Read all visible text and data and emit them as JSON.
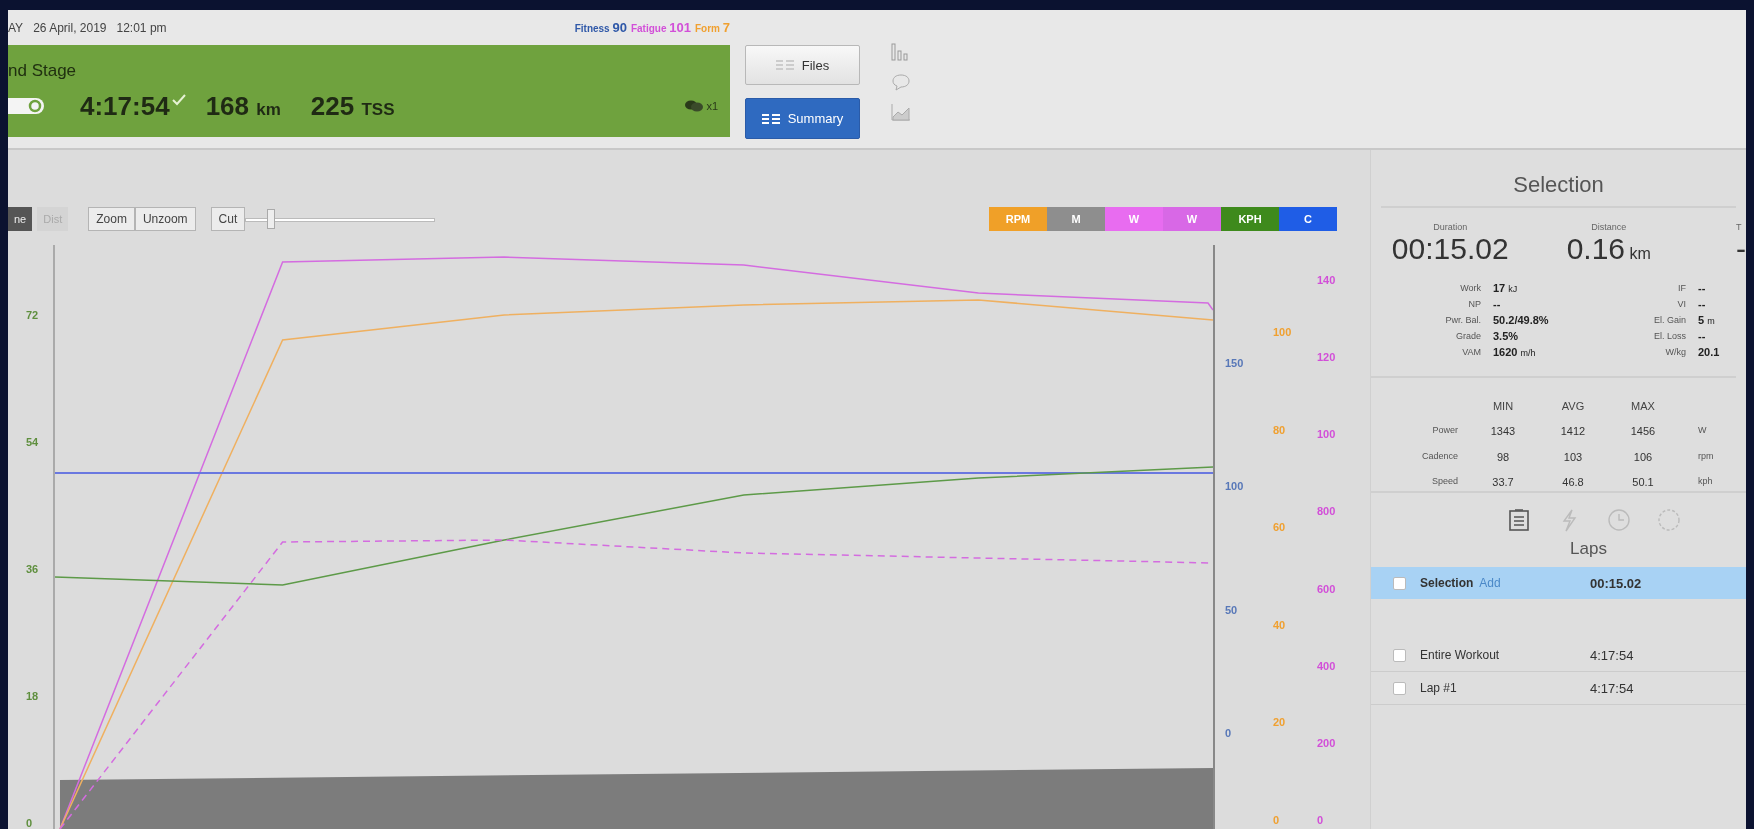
{
  "header": {
    "day": "AY",
    "date": "26 April, 2019",
    "time": "12:01 pm",
    "metrics": [
      {
        "label": "Fitness",
        "value": "90",
        "color": "#2f58a8"
      },
      {
        "label": "Fatigue",
        "value": "101",
        "color": "#d24fd8"
      },
      {
        "label": "Form",
        "value": "7",
        "color": "#f0a030"
      }
    ],
    "workout": {
      "title": "nd Stage",
      "duration": "4:17:54",
      "completed": true,
      "distance": "168",
      "distance_unit": "km",
      "tss": "225",
      "tss_unit": "TSS",
      "comments": "x1"
    },
    "buttons": [
      {
        "label": "Files",
        "selected": false
      },
      {
        "label": "Summary",
        "selected": true
      }
    ],
    "views": [
      {
        "kind": "bars"
      },
      {
        "kind": "comment"
      },
      {
        "kind": "chart"
      }
    ]
  },
  "toolbar": {
    "modes": [
      {
        "label": "ne",
        "selected": true
      },
      {
        "label": "Dist",
        "selected": false
      }
    ],
    "actions": [
      "Zoom",
      "Unzoom",
      "Cut"
    ],
    "zoom": {
      "level": 0.12
    },
    "legend": [
      {
        "label": "RPM",
        "color": "#f0a028"
      },
      {
        "label": "M",
        "color": "#8e8e8e"
      },
      {
        "label": "W",
        "color": "#e86cf0"
      },
      {
        "label": "W",
        "color": "#d868e6"
      },
      {
        "label": "KPH",
        "color": "#3e8a1c"
      },
      {
        "label": "C",
        "color": "#1f5de6"
      }
    ]
  },
  "axes": {
    "left": {
      "color": "#5f8f3e",
      "ticks": [
        "72",
        "54",
        "36",
        "18",
        "0"
      ]
    },
    "right": [
      {
        "color": "#5878b8",
        "ticks": [
          "150",
          "100",
          "50",
          "0"
        ]
      },
      {
        "color": "#f0a030",
        "ticks": [
          "100",
          "80",
          "60",
          "40",
          "20",
          "0"
        ]
      },
      {
        "color": "#d24fd8",
        "ticks": [
          "140",
          "120",
          "100",
          "800",
          "600",
          "400",
          "200",
          "0"
        ]
      }
    ]
  },
  "selection": {
    "title": "Selection",
    "summary": [
      {
        "label": "Duration",
        "value": "00:15.02"
      },
      {
        "label": "Distance",
        "value": "0.16",
        "unit": "km"
      },
      {
        "label": "T",
        "value": "-"
      }
    ],
    "metrics": [
      {
        "label": "Work",
        "value": "17",
        "unit": "kJ"
      },
      {
        "label": "NP",
        "value": "--"
      },
      {
        "label": "Pwr. Bal.",
        "value": "50.2/49.8%"
      },
      {
        "label": "Grade",
        "value": "3.5%"
      },
      {
        "label": "VAM",
        "value": "1620",
        "unit": "m/h"
      }
    ],
    "metrics_right": [
      {
        "label": "IF",
        "value": "--"
      },
      {
        "label": "VI",
        "value": "--"
      },
      {
        "label": "El. Gain",
        "value": "5",
        "unit": "m"
      },
      {
        "label": "El. Loss",
        "value": "--"
      },
      {
        "label": "W/kg",
        "value": "20.1"
      }
    ],
    "stats_columns": [
      "MIN",
      "AVG",
      "MAX"
    ],
    "stats": [
      {
        "label": "Power",
        "min": "1343",
        "avg": "1412",
        "max": "1456",
        "unit": "W"
      },
      {
        "label": "Cadence",
        "min": "98",
        "avg": "103",
        "max": "106",
        "unit": "rpm"
      },
      {
        "label": "Speed",
        "min": "33.7",
        "avg": "46.8",
        "max": "50.1",
        "unit": "kph"
      }
    ]
  },
  "panel_tabs": [
    {
      "kind": "notes",
      "selected": true
    },
    {
      "kind": "power",
      "selected": false
    },
    {
      "kind": "clock",
      "selected": false
    },
    {
      "kind": "circle",
      "selected": false
    }
  ],
  "laps": {
    "title": "Laps",
    "rows": [
      {
        "name": "Selection",
        "action": "Add",
        "time": "00:15.02",
        "selected": true,
        "checked": false
      },
      {
        "name": "Entire Workout",
        "time": "4:17:54",
        "selected": false,
        "checked": false
      },
      {
        "name": "Lap #1",
        "time": "4:17:54",
        "selected": false,
        "checked": false
      }
    ]
  }
}
